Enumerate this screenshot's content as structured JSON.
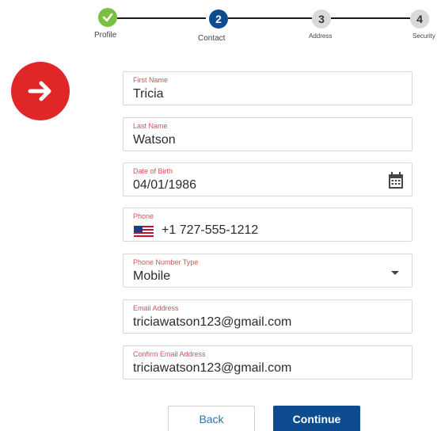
{
  "stepper": {
    "steps": [
      {
        "number": "",
        "label": "Profile",
        "state": "done"
      },
      {
        "number": "2",
        "label": "Contact",
        "state": "active"
      },
      {
        "number": "3",
        "label": "Address",
        "state": "todo"
      },
      {
        "number": "4",
        "label": "Security",
        "state": "todo"
      }
    ]
  },
  "badge": {
    "icon": "arrow-right-icon",
    "color": "#e02626"
  },
  "form": {
    "first_name": {
      "label": "First Name",
      "value": "Tricia"
    },
    "last_name": {
      "label": "Last Name",
      "value": "Watson"
    },
    "dob": {
      "label": "Date of Birth",
      "value": "04/01/1986",
      "icon": "calendar-icon"
    },
    "phone": {
      "label": "Phone",
      "value": "+1 727-555-1212",
      "icon": "us-flag-icon"
    },
    "phone_type": {
      "label": "Phone Number Type",
      "value": "Mobile",
      "icon": "chevron-down-icon"
    },
    "email": {
      "label": "Email Address",
      "value": "triciawatson123@gmail.com"
    },
    "confirm_email": {
      "label": "Confirm Email Address",
      "value": "triciawatson123@gmail.com"
    }
  },
  "buttons": {
    "back": "Back",
    "continue": "Continue"
  },
  "colors": {
    "primary": "#0d4d8f",
    "done": "#7ac143",
    "label": "#d8505c"
  }
}
